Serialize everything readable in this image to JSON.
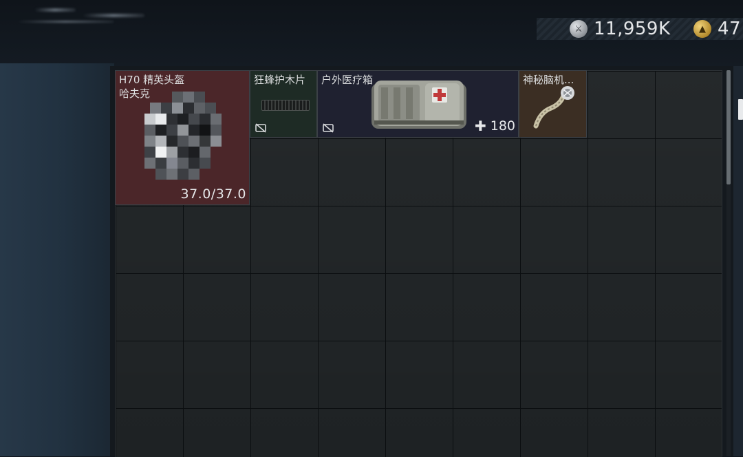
{
  "currency": [
    {
      "icon": "silver-coin-icon",
      "value": "11,959K"
    },
    {
      "icon": "gold-coin-icon",
      "value": "47"
    }
  ],
  "items": {
    "helmet": {
      "name": "H70 精英头盔",
      "subname": "哈夫克",
      "durability": "37.0/37.0",
      "color": "#4b2629",
      "image_obscured": true
    },
    "plate": {
      "name": "狂蜂护木片",
      "color": "#1e2b25",
      "badge": "no-insure-icon"
    },
    "medkit": {
      "name": "户外医疗箱",
      "hp": "180",
      "color": "#1f2130",
      "badge": "no-insure-icon"
    },
    "chip": {
      "name": "神秘脑机...",
      "color": "#3b2e23"
    }
  }
}
